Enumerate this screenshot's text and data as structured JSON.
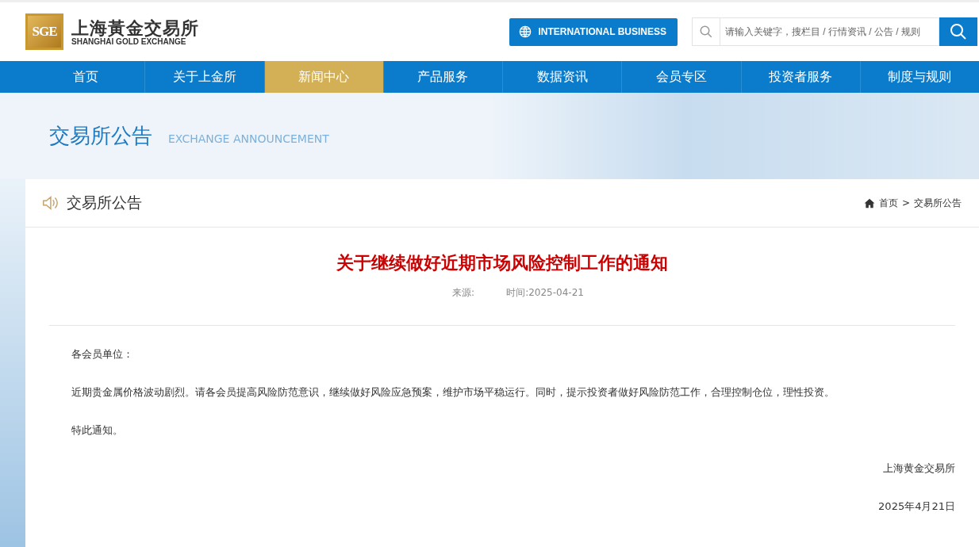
{
  "header": {
    "logo": {
      "mark": "SGE",
      "name_cn": "上海黃金交易所",
      "name_en": "SHANGHAI GOLD EXCHANGE"
    },
    "international_button": "INTERNATIONAL BUSINESS",
    "search": {
      "placeholder": "请输入关键字，搜栏目 / 行情资讯 / 公告 / 规则"
    }
  },
  "nav": [
    {
      "label": "首页",
      "selected": false
    },
    {
      "label": "关于上金所",
      "selected": false
    },
    {
      "label": "新闻中心",
      "selected": true
    },
    {
      "label": "产品服务",
      "selected": false
    },
    {
      "label": "数据资讯",
      "selected": false
    },
    {
      "label": "会员专区",
      "selected": false
    },
    {
      "label": "投资者服务",
      "selected": false
    },
    {
      "label": "制度与规则",
      "selected": false
    }
  ],
  "banner": {
    "title": "交易所公告",
    "subtitle": "EXCHANGE ANNOUNCEMENT"
  },
  "section": {
    "title": "交易所公告",
    "breadcrumb": [
      "首页",
      "交易所公告"
    ],
    "separator": ">"
  },
  "article": {
    "title": "关于继续做好近期市场风险控制工作的通知",
    "source_label": "来源:",
    "time": "时间:2025-04-21",
    "paragraphs": [
      "各会员单位：",
      "近期贵金属价格波动剧烈。请各会员提高风险防范意识，继续做好风险应急预案，维护市场平稳运行。同时，提示投资者做好风险防范工作，合理控制仓位，理性投资。",
      "特此通知。"
    ],
    "signature": [
      "上海黄金交易所",
      "2025年4月21日"
    ]
  }
}
